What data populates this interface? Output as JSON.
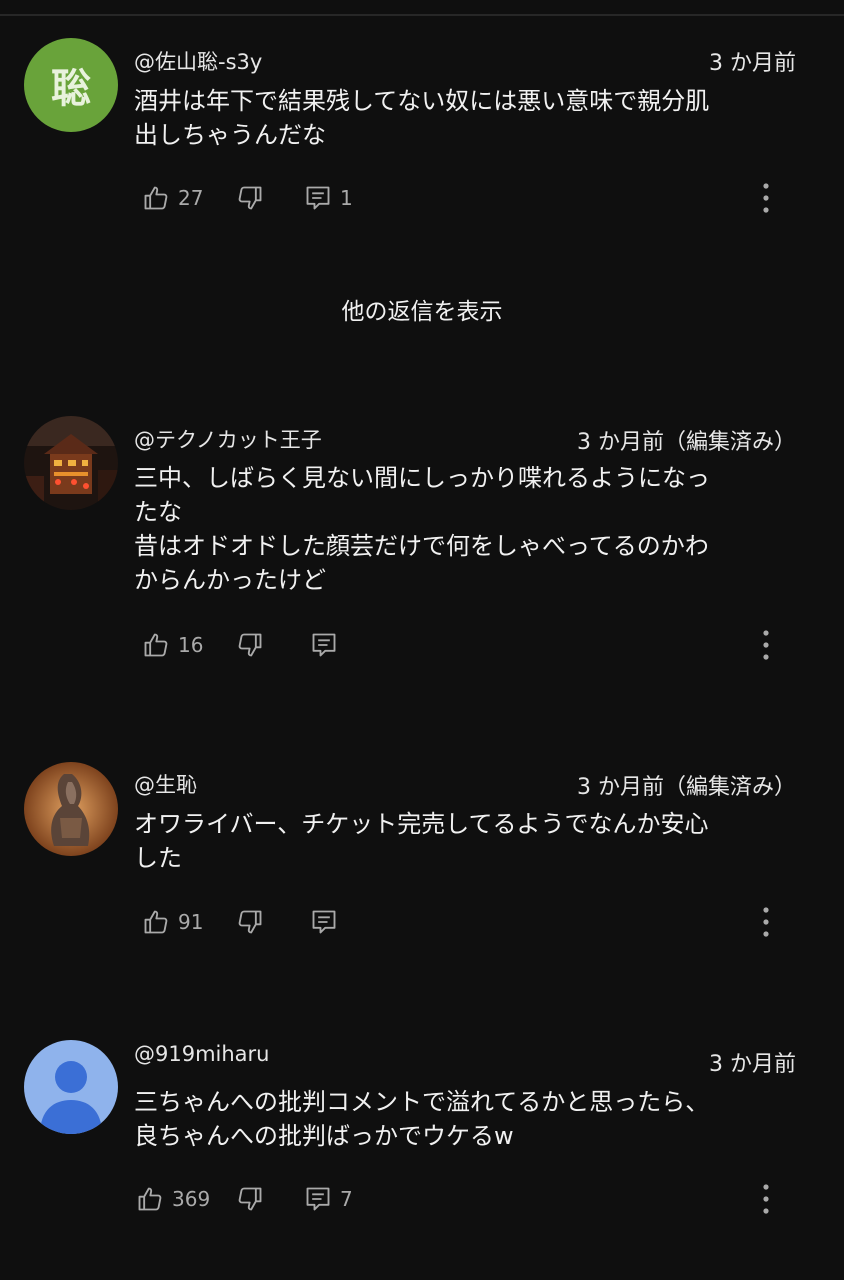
{
  "show_replies_label": "他の返信を表示",
  "comments": [
    {
      "author": "@佐山聡-s3y",
      "avatar_letter": "聡",
      "time": "3 か月前",
      "lines": [
        "酒井は年下で結果残してない奴には悪い意味で親分肌",
        "出しちゃうんだな"
      ],
      "likes": "27",
      "replies": "1"
    },
    {
      "author": "@テクノカット王子",
      "time": "3 か月前（編集済み）",
      "lines": [
        "三中、しばらく見ない間にしっかり喋れるようになっ",
        "たな",
        "昔はオドオドした顔芸だけで何をしゃべってるのかわ",
        "からんかったけど"
      ],
      "likes": "16",
      "replies": ""
    },
    {
      "author": "@生恥",
      "time": "3 か月前（編集済み）",
      "lines": [
        "オワライバー、チケット完売してるようでなんか安心",
        "した"
      ],
      "likes": "91",
      "replies": ""
    },
    {
      "author": "@919miharu",
      "time": "3 か月前",
      "lines": [
        "三ちゃんへの批判コメントで溢れてるかと思ったら、",
        "良ちゃんへの批判ばっかでウケるw"
      ],
      "likes": "369",
      "replies": "7"
    }
  ]
}
